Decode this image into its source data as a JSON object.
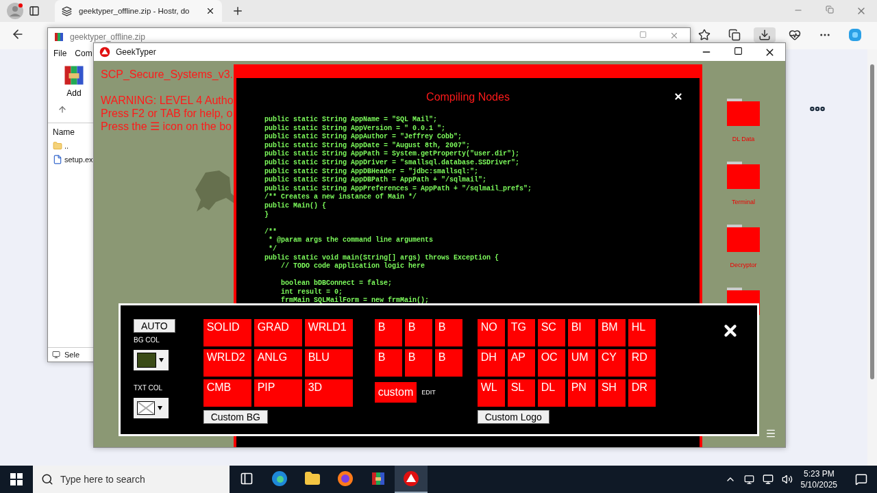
{
  "browser": {
    "tabs": [
      {
        "title": "geektyper_offline.zip - Hostr, do",
        "selected": true
      }
    ]
  },
  "archiver": {
    "title": "geektyper_offline.zip",
    "menu": [
      "File",
      "Com"
    ],
    "toolbar": [
      {
        "label": "Add"
      }
    ],
    "columns": [
      "Name"
    ],
    "files": [
      {
        "name": "..",
        "kind": "folder"
      },
      {
        "name": "setup.ex",
        "kind": "file"
      }
    ],
    "status": "Sele"
  },
  "geektyper": {
    "title": "GeekTyper",
    "messages": [
      "SCP_Secure_Systems_v3.",
      "WARNING: LEVEL 4 Autho",
      "Press F2 or TAB for help, o",
      "Press the ☰ icon on the bo"
    ],
    "dialog": {
      "title": "Compiling Nodes",
      "code_blocks": [
        [
          "public static String AppName = \"SQL Mail\";",
          "public static String AppVersion = \" 0.0.1 \";",
          "public static String AppAuthor = \"Jeffrey Cobb\";",
          "public static String AppDate = \"August 8th, 2007\";",
          "public static String AppPath = System.getProperty(\"user.dir\");",
          "public static String AppDriver = \"smallsql.database.SSDriver\";",
          "public static String AppDBHeader = \"jdbc:smallsql:\";",
          "public static String AppDBPath = AppPath + \"/sqlmail\";",
          "public static String AppPreferences = AppPath + \"/sqlmail_prefs\";",
          "/** Creates a new instance of Main */",
          "public Main() {",
          "}"
        ],
        [
          "/**",
          " * @param args the command line arguments",
          " */",
          "public static void main(String[] args) throws Exception {",
          "    // TODO code application logic here"
        ],
        [
          "    boolean bDBConnect = false;",
          "    int result = 0;",
          "    frmMain SQLMailForm = new frmMain();"
        ]
      ]
    },
    "desktop_icons": [
      {
        "kind": "folder",
        "label": "DL Data"
      },
      {
        "kind": "folder",
        "label": "Terminal"
      },
      {
        "kind": "folder",
        "label": "Decryptor"
      },
      {
        "kind": "folder"
      }
    ],
    "panel": {
      "auto": "AUTO",
      "bg_col_label": "BG COL",
      "txt_col_label": "TXT COL",
      "styles": [
        "SOLID",
        "GRAD",
        "WRLD1",
        "WRLD2",
        "ANLG",
        "BLU",
        "CMB",
        "PIP",
        "3D"
      ],
      "custom_bg": "Custom BG",
      "b_buttons": [
        "B",
        "B",
        "B",
        "B",
        "B",
        "B"
      ],
      "custom": "custom",
      "edit": "EDIT",
      "logos": [
        "NO",
        "TG",
        "SC",
        "BI",
        "BM",
        "HL",
        "DH",
        "AP",
        "OC",
        "UM",
        "CY",
        "RD",
        "WL",
        "SL",
        "DL",
        "PN",
        "SH",
        "DR"
      ],
      "custom_logo": "Custom Logo"
    }
  },
  "taskbar": {
    "search": {
      "placeholder": "Type here to search"
    },
    "apps": [
      {
        "kind": "taskview",
        "selected": false
      },
      {
        "kind": "edge",
        "selected": false
      },
      {
        "kind": "explorer",
        "selected": false
      },
      {
        "kind": "firefox",
        "selected": false
      },
      {
        "kind": "winrar",
        "selected": false
      },
      {
        "kind": "geektyper",
        "selected": true
      }
    ],
    "time": "5:23 PM",
    "date": "5/10/2025"
  }
}
